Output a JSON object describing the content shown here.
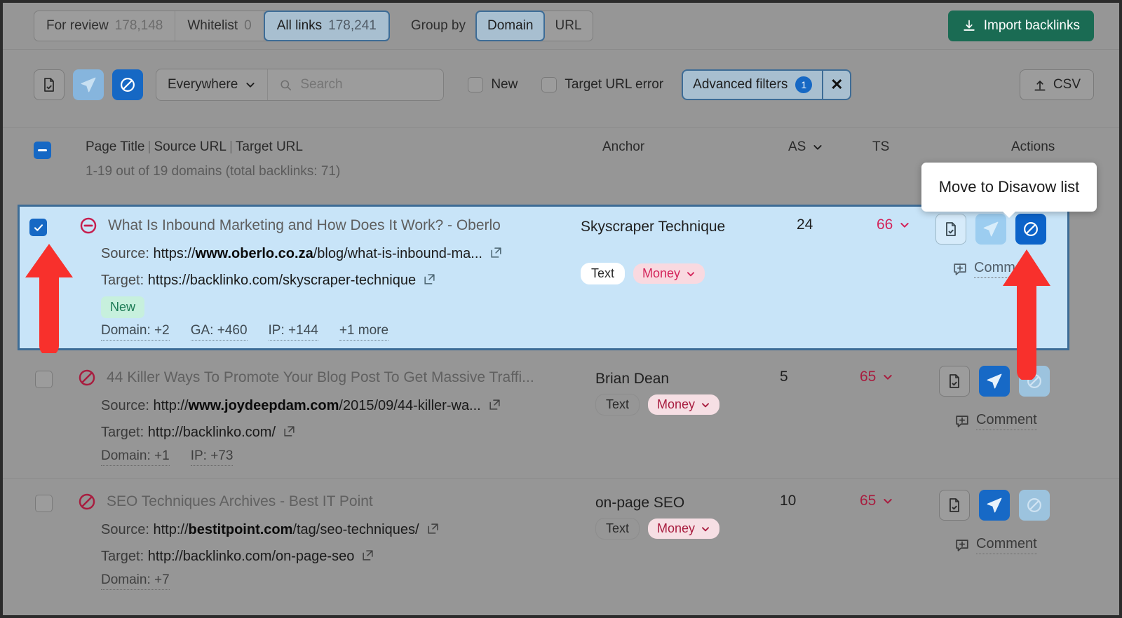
{
  "topbar": {
    "tabs": [
      {
        "label": "For review",
        "count": "178,148",
        "active": false
      },
      {
        "label": "Whitelist",
        "count": "0",
        "active": false
      },
      {
        "label": "All links",
        "count": "178,241",
        "active": true
      }
    ],
    "group_by_label": "Group by",
    "group_options": [
      {
        "label": "Domain",
        "active": true
      },
      {
        "label": "URL",
        "active": false
      }
    ],
    "import_button": "Import backlinks",
    "import_icon": "download-icon",
    "import_color": "#1a6b53"
  },
  "filterbar": {
    "action_icons": [
      {
        "name": "report-check-icon",
        "style": "outline"
      },
      {
        "name": "send-icon",
        "style": "blue-light"
      },
      {
        "name": "disavow-icon",
        "style": "blue-solid"
      }
    ],
    "scope_select": "Everywhere",
    "scope_chevron": "chevron-down-icon",
    "search_icon": "search-icon",
    "search_value": "",
    "search_placeholder": "Search",
    "checkboxes": [
      {
        "label": "New",
        "checked": false
      },
      {
        "label": "Target URL error",
        "checked": false
      }
    ],
    "advanced_filters_label": "Advanced filters",
    "advanced_filters_count": "1",
    "advanced_filters_close": "✕",
    "csv_label": "CSV",
    "csv_icon": "upload-icon"
  },
  "table_header": {
    "select_all_state": "indeterminate",
    "title_parts": [
      "Page Title",
      "Source URL",
      "Target URL"
    ],
    "summary": "1-19 out of 19 domains (total backlinks: 71)",
    "columns": {
      "anchor": "Anchor",
      "as": "AS",
      "as_sort_icon": "chevron-down-icon",
      "ts": "TS",
      "actions": "Actions"
    }
  },
  "tooltip": {
    "text": "Move to Disavow list"
  },
  "rows": [
    {
      "selected": true,
      "checked": true,
      "status_icon": "minus-circle-icon",
      "title": "What Is Inbound Marketing and How Does It Work? - Oberlo",
      "source_label": "Source:",
      "source_prefix": "https://",
      "source_domain": "www.oberlo.co.za",
      "source_path": "/blog/what-is-inbound-ma...",
      "target_label": "Target:",
      "target_prefix": "https://",
      "target_domain": "",
      "target_path": "backlinko.com/skyscraper-technique",
      "badge": "New",
      "metrics": [
        "Domain: +2",
        "GA: +460",
        "IP: +144",
        "+1 more"
      ],
      "anchor": "Skyscraper Technique",
      "tags": {
        "text": "Text",
        "money": "Money"
      },
      "as": "24",
      "ts": "66",
      "actions": [
        {
          "name": "report-check-icon",
          "style": "outline"
        },
        {
          "name": "send-icon",
          "style": "blue-pale"
        },
        {
          "name": "disavow-icon",
          "style": "blue-solid"
        }
      ],
      "comment": "Comment"
    },
    {
      "selected": false,
      "checked": false,
      "status_icon": "disavow-circle-icon",
      "title": "44 Killer Ways To Promote Your Blog Post To Get Massive Traffi...",
      "source_label": "Source:",
      "source_prefix": "http://",
      "source_domain": "www.joydeepdam.com",
      "source_path": "/2015/09/44-killer-wa...",
      "target_label": "Target:",
      "target_prefix": "http://",
      "target_domain": "",
      "target_path": "backlinko.com/",
      "badge": "",
      "metrics": [
        "Domain: +1",
        "IP: +73"
      ],
      "anchor": "Brian Dean",
      "tags": {
        "text": "Text",
        "money": "Money"
      },
      "as": "5",
      "ts": "65",
      "actions": [
        {
          "name": "report-check-icon",
          "style": "outline"
        },
        {
          "name": "send-icon",
          "style": "blue-mid"
        },
        {
          "name": "disavow-icon",
          "style": "blue-pale"
        }
      ],
      "comment": "Comment"
    },
    {
      "selected": false,
      "checked": false,
      "status_icon": "disavow-circle-icon",
      "title": "SEO Techniques Archives - Best IT Point",
      "source_label": "Source:",
      "source_prefix": "http://",
      "source_domain": "bestitpoint.com",
      "source_path": "/tag/seo-techniques/",
      "target_label": "Target:",
      "target_prefix": "http://",
      "target_domain": "",
      "target_path": "backlinko.com/on-page-seo",
      "badge": "",
      "metrics": [
        "Domain: +7"
      ],
      "anchor": "on-page SEO",
      "tags": {
        "text": "Text",
        "money": "Money"
      },
      "as": "10",
      "ts": "65",
      "actions": [
        {
          "name": "report-check-icon",
          "style": "outline"
        },
        {
          "name": "send-icon",
          "style": "blue-mid"
        },
        {
          "name": "disavow-icon",
          "style": "blue-pale"
        }
      ],
      "comment": "Comment"
    }
  ],
  "annotations": {
    "arrow_color": "#f8302c",
    "arrows": [
      "checkbox-arrow",
      "disavow-action-arrow"
    ]
  }
}
